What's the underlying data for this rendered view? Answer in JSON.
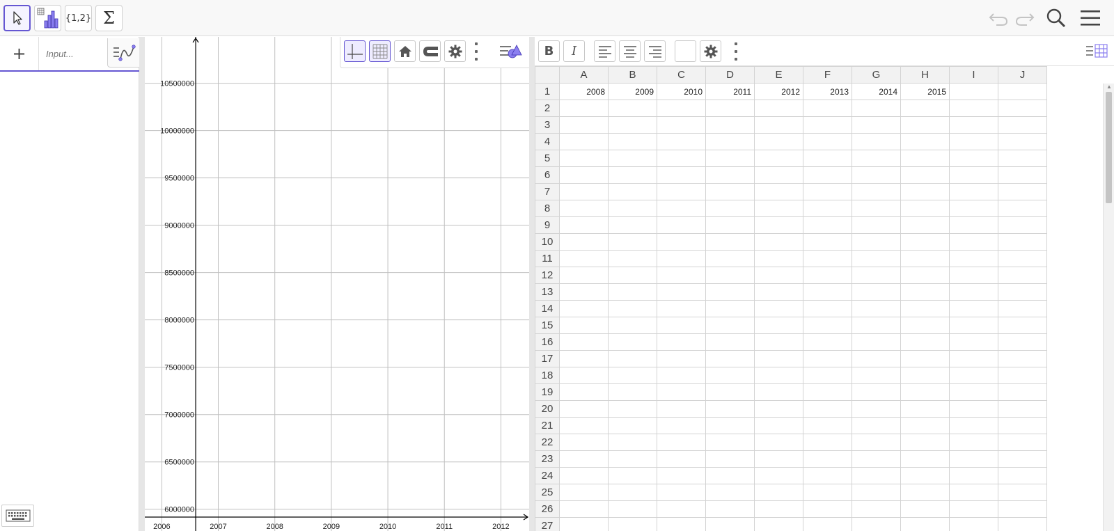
{
  "toolbar": {
    "tools": [
      {
        "name": "move-tool",
        "label": ""
      },
      {
        "name": "one-variable-analysis-tool",
        "label": ""
      },
      {
        "name": "create-list-tool",
        "label": "{1,2}"
      },
      {
        "name": "sum-tool",
        "label": "Σ"
      }
    ],
    "right_icons": [
      "undo-icon",
      "redo-icon",
      "search-icon",
      "menu-icon"
    ]
  },
  "algebra": {
    "plus_label": "+",
    "input_placeholder": "Input..."
  },
  "graphics": {
    "x_ticks": [
      "2006",
      "2007",
      "2008",
      "2009",
      "2010",
      "2011",
      "2012"
    ],
    "y_ticks": [
      "6000000",
      "6500000",
      "7000000",
      "7500000",
      "8000000",
      "8500000",
      "9000000",
      "9500000",
      "10000000",
      "10500000"
    ],
    "x_range": [
      2005.7,
      2012.5
    ],
    "y_range": [
      5770000,
      10990000
    ]
  },
  "spreadsheet": {
    "columns": [
      "A",
      "B",
      "C",
      "D",
      "E",
      "F",
      "G",
      "H",
      "I",
      "J"
    ],
    "rows": [
      {
        "num": "1",
        "cells": [
          "2008",
          "2009",
          "2010",
          "2011",
          "2012",
          "2013",
          "2014",
          "2015",
          "",
          ""
        ]
      },
      {
        "num": "2",
        "cells": [
          "",
          "",
          "",
          "",
          "",
          "",
          "",
          "",
          "",
          ""
        ]
      },
      {
        "num": "3",
        "cells": [
          "",
          "",
          "",
          "",
          "",
          "",
          "",
          "",
          "",
          ""
        ]
      },
      {
        "num": "4",
        "cells": [
          "",
          "",
          "",
          "",
          "",
          "",
          "",
          "",
          "",
          ""
        ]
      },
      {
        "num": "5",
        "cells": [
          "",
          "",
          "",
          "",
          "",
          "",
          "",
          "",
          "",
          ""
        ]
      },
      {
        "num": "6",
        "cells": [
          "",
          "",
          "",
          "",
          "",
          "",
          "",
          "",
          "",
          ""
        ]
      },
      {
        "num": "7",
        "cells": [
          "",
          "",
          "",
          "",
          "",
          "",
          "",
          "",
          "",
          ""
        ]
      },
      {
        "num": "8",
        "cells": [
          "",
          "",
          "",
          "",
          "",
          "",
          "",
          "",
          "",
          ""
        ]
      },
      {
        "num": "9",
        "cells": [
          "",
          "",
          "",
          "",
          "",
          "",
          "",
          "",
          "",
          ""
        ]
      },
      {
        "num": "10",
        "cells": [
          "",
          "",
          "",
          "",
          "",
          "",
          "",
          "",
          "",
          ""
        ]
      },
      {
        "num": "11",
        "cells": [
          "",
          "",
          "",
          "",
          "",
          "",
          "",
          "",
          "",
          ""
        ]
      },
      {
        "num": "12",
        "cells": [
          "",
          "",
          "",
          "",
          "",
          "",
          "",
          "",
          "",
          ""
        ]
      },
      {
        "num": "13",
        "cells": [
          "",
          "",
          "",
          "",
          "",
          "",
          "",
          "",
          "",
          ""
        ]
      },
      {
        "num": "14",
        "cells": [
          "",
          "",
          "",
          "",
          "",
          "",
          "",
          "",
          "",
          ""
        ]
      },
      {
        "num": "15",
        "cells": [
          "",
          "",
          "",
          "",
          "",
          "",
          "",
          "",
          "",
          ""
        ]
      },
      {
        "num": "16",
        "cells": [
          "",
          "",
          "",
          "",
          "",
          "",
          "",
          "",
          "",
          ""
        ]
      },
      {
        "num": "17",
        "cells": [
          "",
          "",
          "",
          "",
          "",
          "",
          "",
          "",
          "",
          ""
        ]
      },
      {
        "num": "18",
        "cells": [
          "",
          "",
          "",
          "",
          "",
          "",
          "",
          "",
          "",
          ""
        ]
      },
      {
        "num": "19",
        "cells": [
          "",
          "",
          "",
          "",
          "",
          "",
          "",
          "",
          "",
          ""
        ]
      },
      {
        "num": "20",
        "cells": [
          "",
          "",
          "",
          "",
          "",
          "",
          "",
          "",
          "",
          ""
        ]
      },
      {
        "num": "21",
        "cells": [
          "",
          "",
          "",
          "",
          "",
          "",
          "",
          "",
          "",
          ""
        ]
      },
      {
        "num": "22",
        "cells": [
          "",
          "",
          "",
          "",
          "",
          "",
          "",
          "",
          "",
          ""
        ]
      },
      {
        "num": "23",
        "cells": [
          "",
          "",
          "",
          "",
          "",
          "",
          "",
          "",
          "",
          ""
        ]
      },
      {
        "num": "24",
        "cells": [
          "",
          "",
          "",
          "",
          "",
          "",
          "",
          "",
          "",
          ""
        ]
      },
      {
        "num": "25",
        "cells": [
          "",
          "",
          "",
          "",
          "",
          "",
          "",
          "",
          "",
          ""
        ]
      },
      {
        "num": "26",
        "cells": [
          "",
          "",
          "",
          "",
          "",
          "",
          "",
          "",
          "",
          ""
        ]
      },
      {
        "num": "27",
        "cells": [
          "",
          "",
          "",
          "",
          "",
          "",
          "",
          "",
          "",
          ""
        ]
      }
    ]
  },
  "colors": {
    "accent": "#6557d2",
    "axis": "#000000",
    "grid": "#c0c0c0",
    "header_bg": "#f2f2f2"
  }
}
